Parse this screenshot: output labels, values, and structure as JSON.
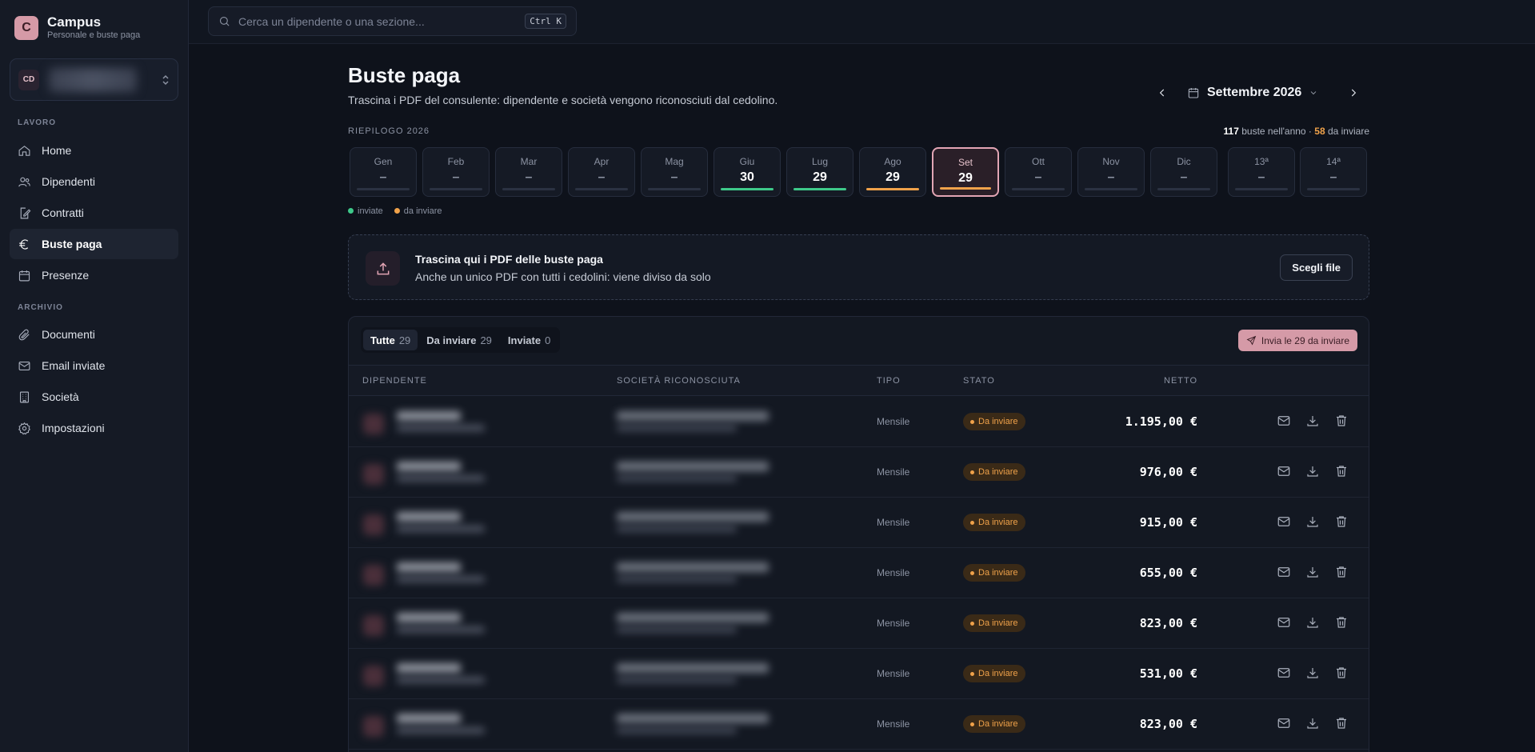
{
  "brand": {
    "logo_letter": "C",
    "name": "Campus",
    "subtitle": "Personale e buste paga"
  },
  "switcher": {
    "initials": "CD"
  },
  "nav": {
    "section_lavoro": "LAVORO",
    "section_archivio": "ARCHIVIO",
    "items": [
      {
        "label": "Home",
        "icon": "home-icon"
      },
      {
        "label": "Dipendenti",
        "icon": "users-icon"
      },
      {
        "label": "Contratti",
        "icon": "contract-icon"
      },
      {
        "label": "Buste paga",
        "icon": "euro-icon"
      },
      {
        "label": "Presenze",
        "icon": "calendar-icon"
      },
      {
        "label": "Documenti",
        "icon": "paperclip-icon"
      },
      {
        "label": "Email inviate",
        "icon": "mail-icon"
      },
      {
        "label": "Società",
        "icon": "building-icon"
      },
      {
        "label": "Impostazioni",
        "icon": "gear-icon"
      }
    ]
  },
  "search": {
    "placeholder": "Cerca un dipendente o una sezione...",
    "shortcut": "Ctrl K"
  },
  "page": {
    "title": "Buste paga",
    "subtitle": "Trascina i PDF del consulente: dipendente e società vengono riconosciuti dal cedolino.",
    "selected_month": "Settembre 2026"
  },
  "summary": {
    "label": "RIEPILOGO 2026",
    "total": "117",
    "total_suffix": " buste nell'anno · ",
    "pending": "58",
    "pending_suffix": " da inviare",
    "months": [
      {
        "name": "Gen",
        "value": "–",
        "status": "none"
      },
      {
        "name": "Feb",
        "value": "–",
        "status": "none"
      },
      {
        "name": "Mar",
        "value": "–",
        "status": "none"
      },
      {
        "name": "Apr",
        "value": "–",
        "status": "none"
      },
      {
        "name": "Mag",
        "value": "–",
        "status": "none"
      },
      {
        "name": "Giu",
        "value": "30",
        "status": "sent"
      },
      {
        "name": "Lug",
        "value": "29",
        "status": "sent"
      },
      {
        "name": "Ago",
        "value": "29",
        "status": "pending"
      },
      {
        "name": "Set",
        "value": "29",
        "status": "pending"
      },
      {
        "name": "Ott",
        "value": "–",
        "status": "none"
      },
      {
        "name": "Nov",
        "value": "–",
        "status": "none"
      },
      {
        "name": "Dic",
        "value": "–",
        "status": "none"
      },
      {
        "name": "13ª",
        "value": "–",
        "status": "none"
      },
      {
        "name": "14ª",
        "value": "–",
        "status": "none"
      }
    ],
    "legend_sent": "inviate",
    "legend_pending": "da inviare",
    "colors": {
      "sent": "#3ec98a",
      "pending": "#f0a24a"
    }
  },
  "dropzone": {
    "title": "Trascina qui i PDF delle buste paga",
    "subtitle": "Anche un unico PDF con tutti i cedolini: viene diviso da solo",
    "button": "Scegli file"
  },
  "table": {
    "tabs": [
      {
        "label": "Tutte",
        "count": "29"
      },
      {
        "label": "Da inviare",
        "count": "29"
      },
      {
        "label": "Inviate",
        "count": "0"
      }
    ],
    "send_button": "Invia le 29 da inviare",
    "headers": {
      "employee": "DIPENDENTE",
      "company": "SOCIETÀ RICONOSCIUTA",
      "type": "TIPO",
      "status": "STATO",
      "net": "NETTO"
    },
    "rows": [
      {
        "tipo": "Mensile",
        "stato": "Da inviare",
        "netto": "1.195,00 €"
      },
      {
        "tipo": "Mensile",
        "stato": "Da inviare",
        "netto": "976,00 €"
      },
      {
        "tipo": "Mensile",
        "stato": "Da inviare",
        "netto": "915,00 €"
      },
      {
        "tipo": "Mensile",
        "stato": "Da inviare",
        "netto": "655,00 €"
      },
      {
        "tipo": "Mensile",
        "stato": "Da inviare",
        "netto": "823,00 €"
      },
      {
        "tipo": "Mensile",
        "stato": "Da inviare",
        "netto": "531,00 €"
      },
      {
        "tipo": "Mensile",
        "stato": "Da inviare",
        "netto": "823,00 €"
      }
    ]
  }
}
